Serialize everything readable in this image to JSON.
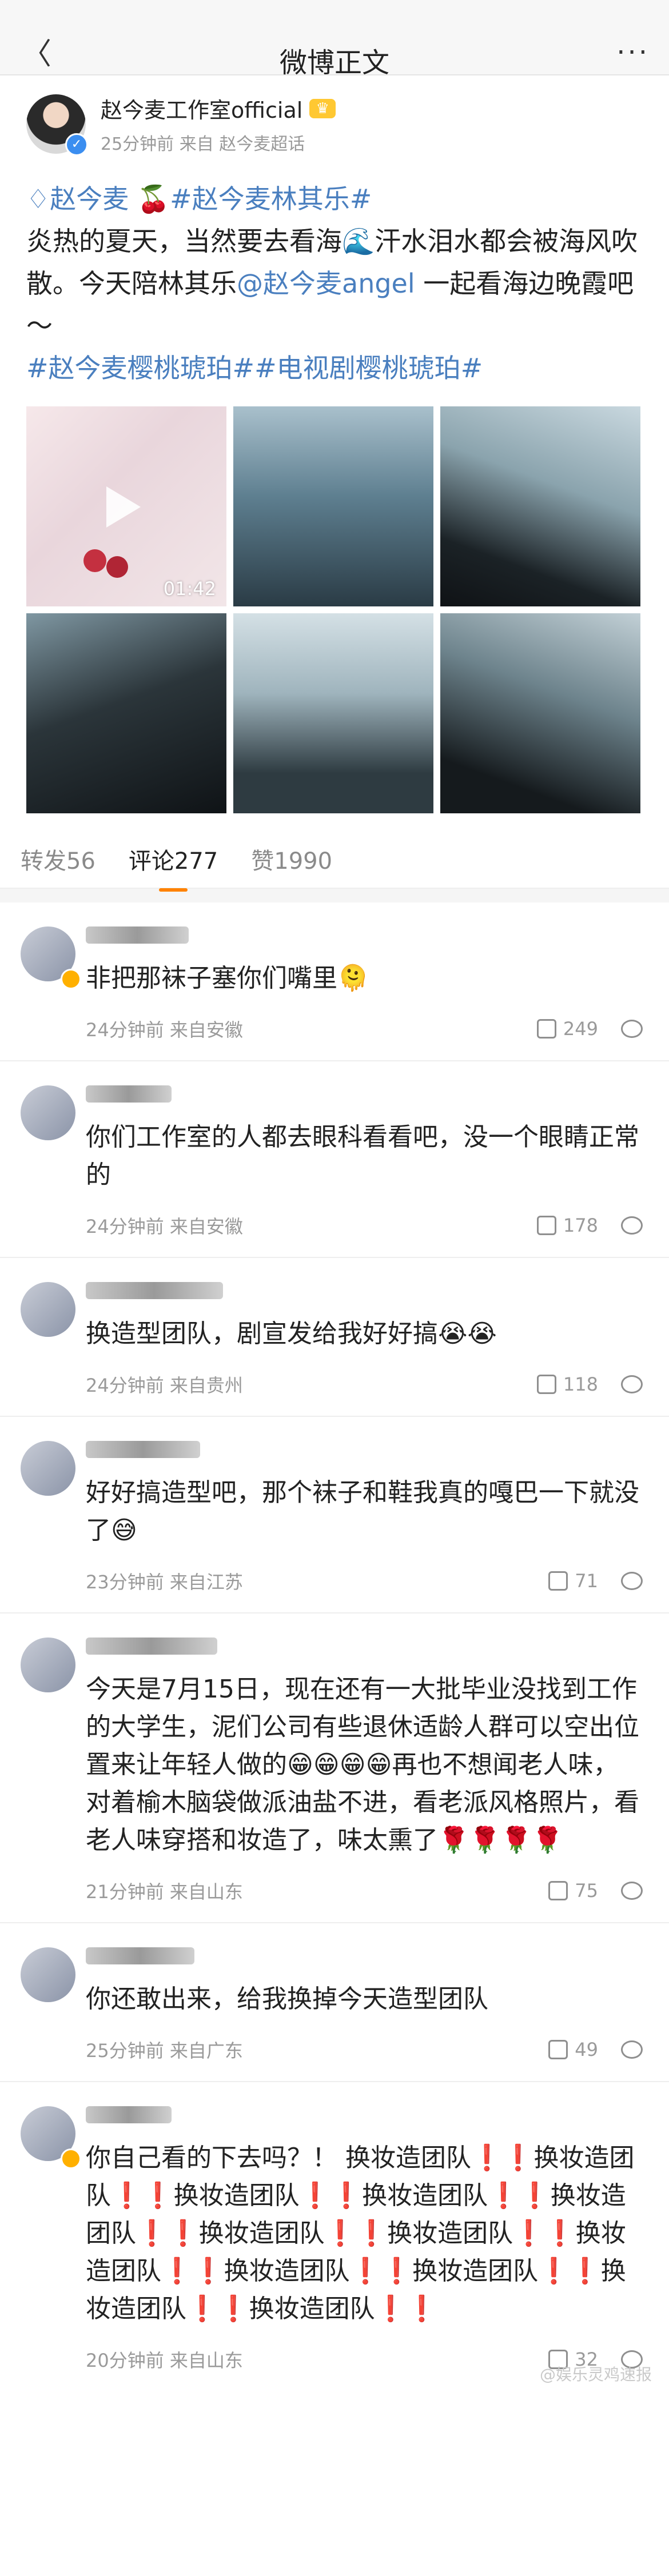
{
  "nav": {
    "back": "〈",
    "title": "微博正文",
    "more": "···"
  },
  "post": {
    "author": "赵今麦工作室official",
    "meta": "25分钟前  来自 赵今麦超话",
    "tag1": "赵今麦",
    "tag2": "#赵今麦林其乐#",
    "text1": "炎热的夏天，当然要去看海",
    "wave": "🌊",
    "text2": "汗水泪水都会被海风吹散。今天陪林其乐",
    "mention": "@赵今麦angel",
    "text3": " 一起看海边晚霞吧～",
    "tags_line": "#赵今麦樱桃琥珀##电视剧樱桃琥珀#",
    "video_duration": "01:42"
  },
  "tabs": {
    "repost": "转发56",
    "comment": "评论277",
    "like": "赞1990"
  },
  "comments": [
    {
      "text": "非把那袜子塞你们嘴里🫠",
      "time": "24分钟前 来自安徽",
      "likes": "249"
    },
    {
      "text": "你们工作室的人都去眼科看看吧，没一个眼睛正常的",
      "time": "24分钟前 来自安徽",
      "likes": "178"
    },
    {
      "text": "换造型团队，剧宣发给我好好搞😭😭",
      "time": "24分钟前 来自贵州",
      "likes": "118"
    },
    {
      "text": "好好搞造型吧，那个袜子和鞋我真的嘎巴一下就没了😅",
      "time": "23分钟前 来自江苏",
      "likes": "71"
    },
    {
      "text": "今天是7月15日，现在还有一大批毕业没找到工作的大学生，泥们公司有些退休适龄人群可以空出位置来让年轻人做的😁😁😁😁再也不想闻老人味，对着榆木脑袋做派油盐不进，看老派风格照片，看老人味穿搭和妆造了，味太熏了🌹🌹🌹🌹",
      "time": "21分钟前 来自山东",
      "likes": "75"
    },
    {
      "text": "你还敢出来，给我换掉今天造型团队",
      "time": "25分钟前 来自广东",
      "likes": "49"
    },
    {
      "text": "你自己看的下去吗？！ 换妆造团队❗❗换妆造团队❗❗换妆造团队❗❗换妆造团队❗❗换妆造团队❗❗换妆造团队❗❗换妆造团队❗❗换妆造团队❗❗换妆造团队❗❗换妆造团队❗❗换妆造团队❗❗换妆造团队❗❗",
      "time": "20分钟前 来自山东",
      "likes": "32"
    }
  ],
  "watermark": "@娱乐灵鸡速报"
}
